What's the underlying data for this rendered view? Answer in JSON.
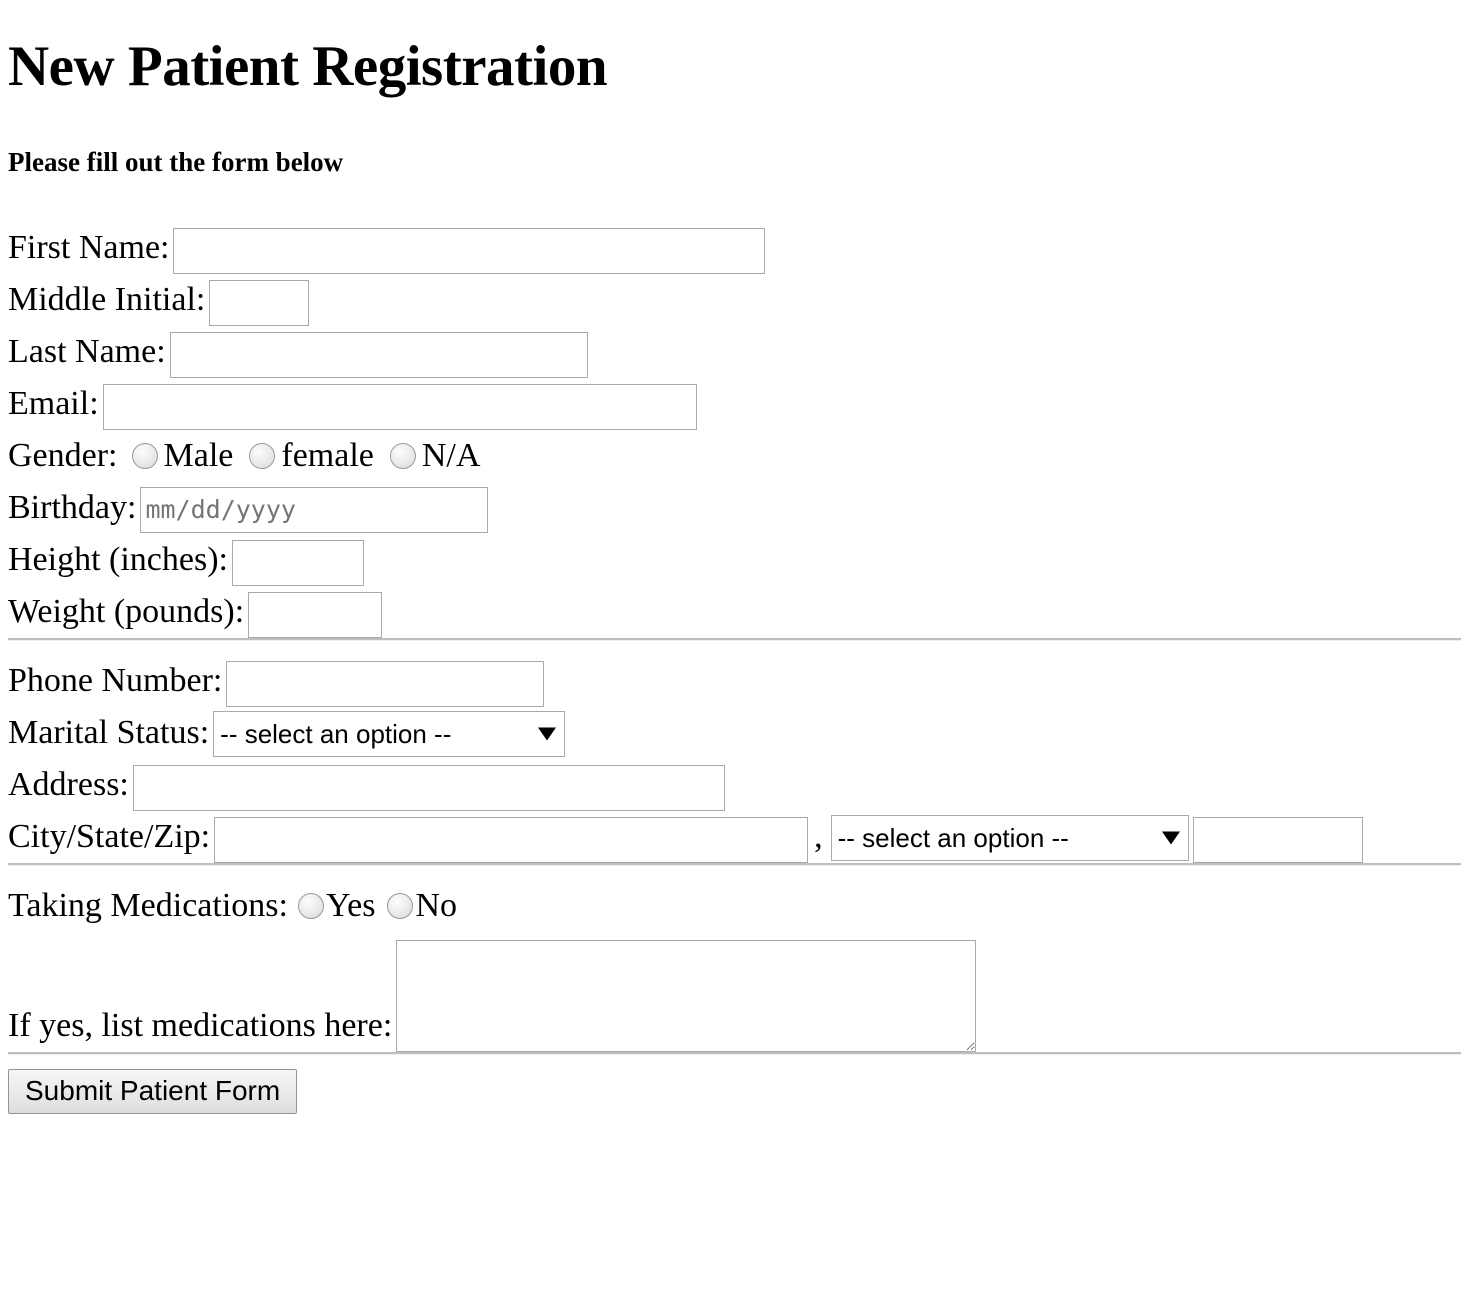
{
  "header": {
    "title": "New Patient Registration",
    "subtitle": "Please fill out the form below"
  },
  "section_personal": {
    "first_name": {
      "label": "First Name:",
      "value": "",
      "placeholder": ""
    },
    "middle_initial": {
      "label": "Middle Initial:",
      "value": "",
      "placeholder": ""
    },
    "last_name": {
      "label": "Last Name:",
      "value": "",
      "placeholder": ""
    },
    "email": {
      "label": "Email:",
      "value": "",
      "placeholder": ""
    },
    "gender": {
      "label": "Gender:",
      "options": [
        "Male",
        "female",
        "N/A"
      ],
      "selected": ""
    },
    "birthday": {
      "label": "Birthday:",
      "value": "",
      "placeholder": "mm/dd/yyyy"
    },
    "height": {
      "label": "Height (inches):",
      "value": "",
      "placeholder": ""
    },
    "weight": {
      "label": "Weight (pounds):",
      "value": "",
      "placeholder": ""
    }
  },
  "section_contact": {
    "phone": {
      "label": "Phone Number:",
      "value": "",
      "placeholder": ""
    },
    "marital_status": {
      "label": "Marital Status:",
      "selected": "-- select an option --",
      "options": [
        "-- select an option --"
      ]
    },
    "address": {
      "label": "Address:",
      "value": "",
      "placeholder": ""
    },
    "city_state_zip": {
      "label": "City/State/Zip:",
      "city_value": "",
      "separator": ",",
      "state_selected": "-- select an option --",
      "state_options": [
        "-- select an option --"
      ],
      "zip_value": ""
    }
  },
  "section_medications": {
    "taking_medications": {
      "label": "Taking Medications:",
      "options": [
        "Yes",
        "No"
      ],
      "selected": ""
    },
    "medications_list": {
      "label": "If yes, list medications here:",
      "value": "",
      "placeholder": ""
    }
  },
  "footer": {
    "submit_label": "Submit Patient Form"
  },
  "icons": {
    "dropdown_arrow": "chevron-down-icon"
  },
  "colors": {
    "text": "#000000",
    "background": "#ffffff",
    "input_border": "#a9a9a9",
    "divider": "#bfbfbf",
    "button_border": "#949494"
  }
}
